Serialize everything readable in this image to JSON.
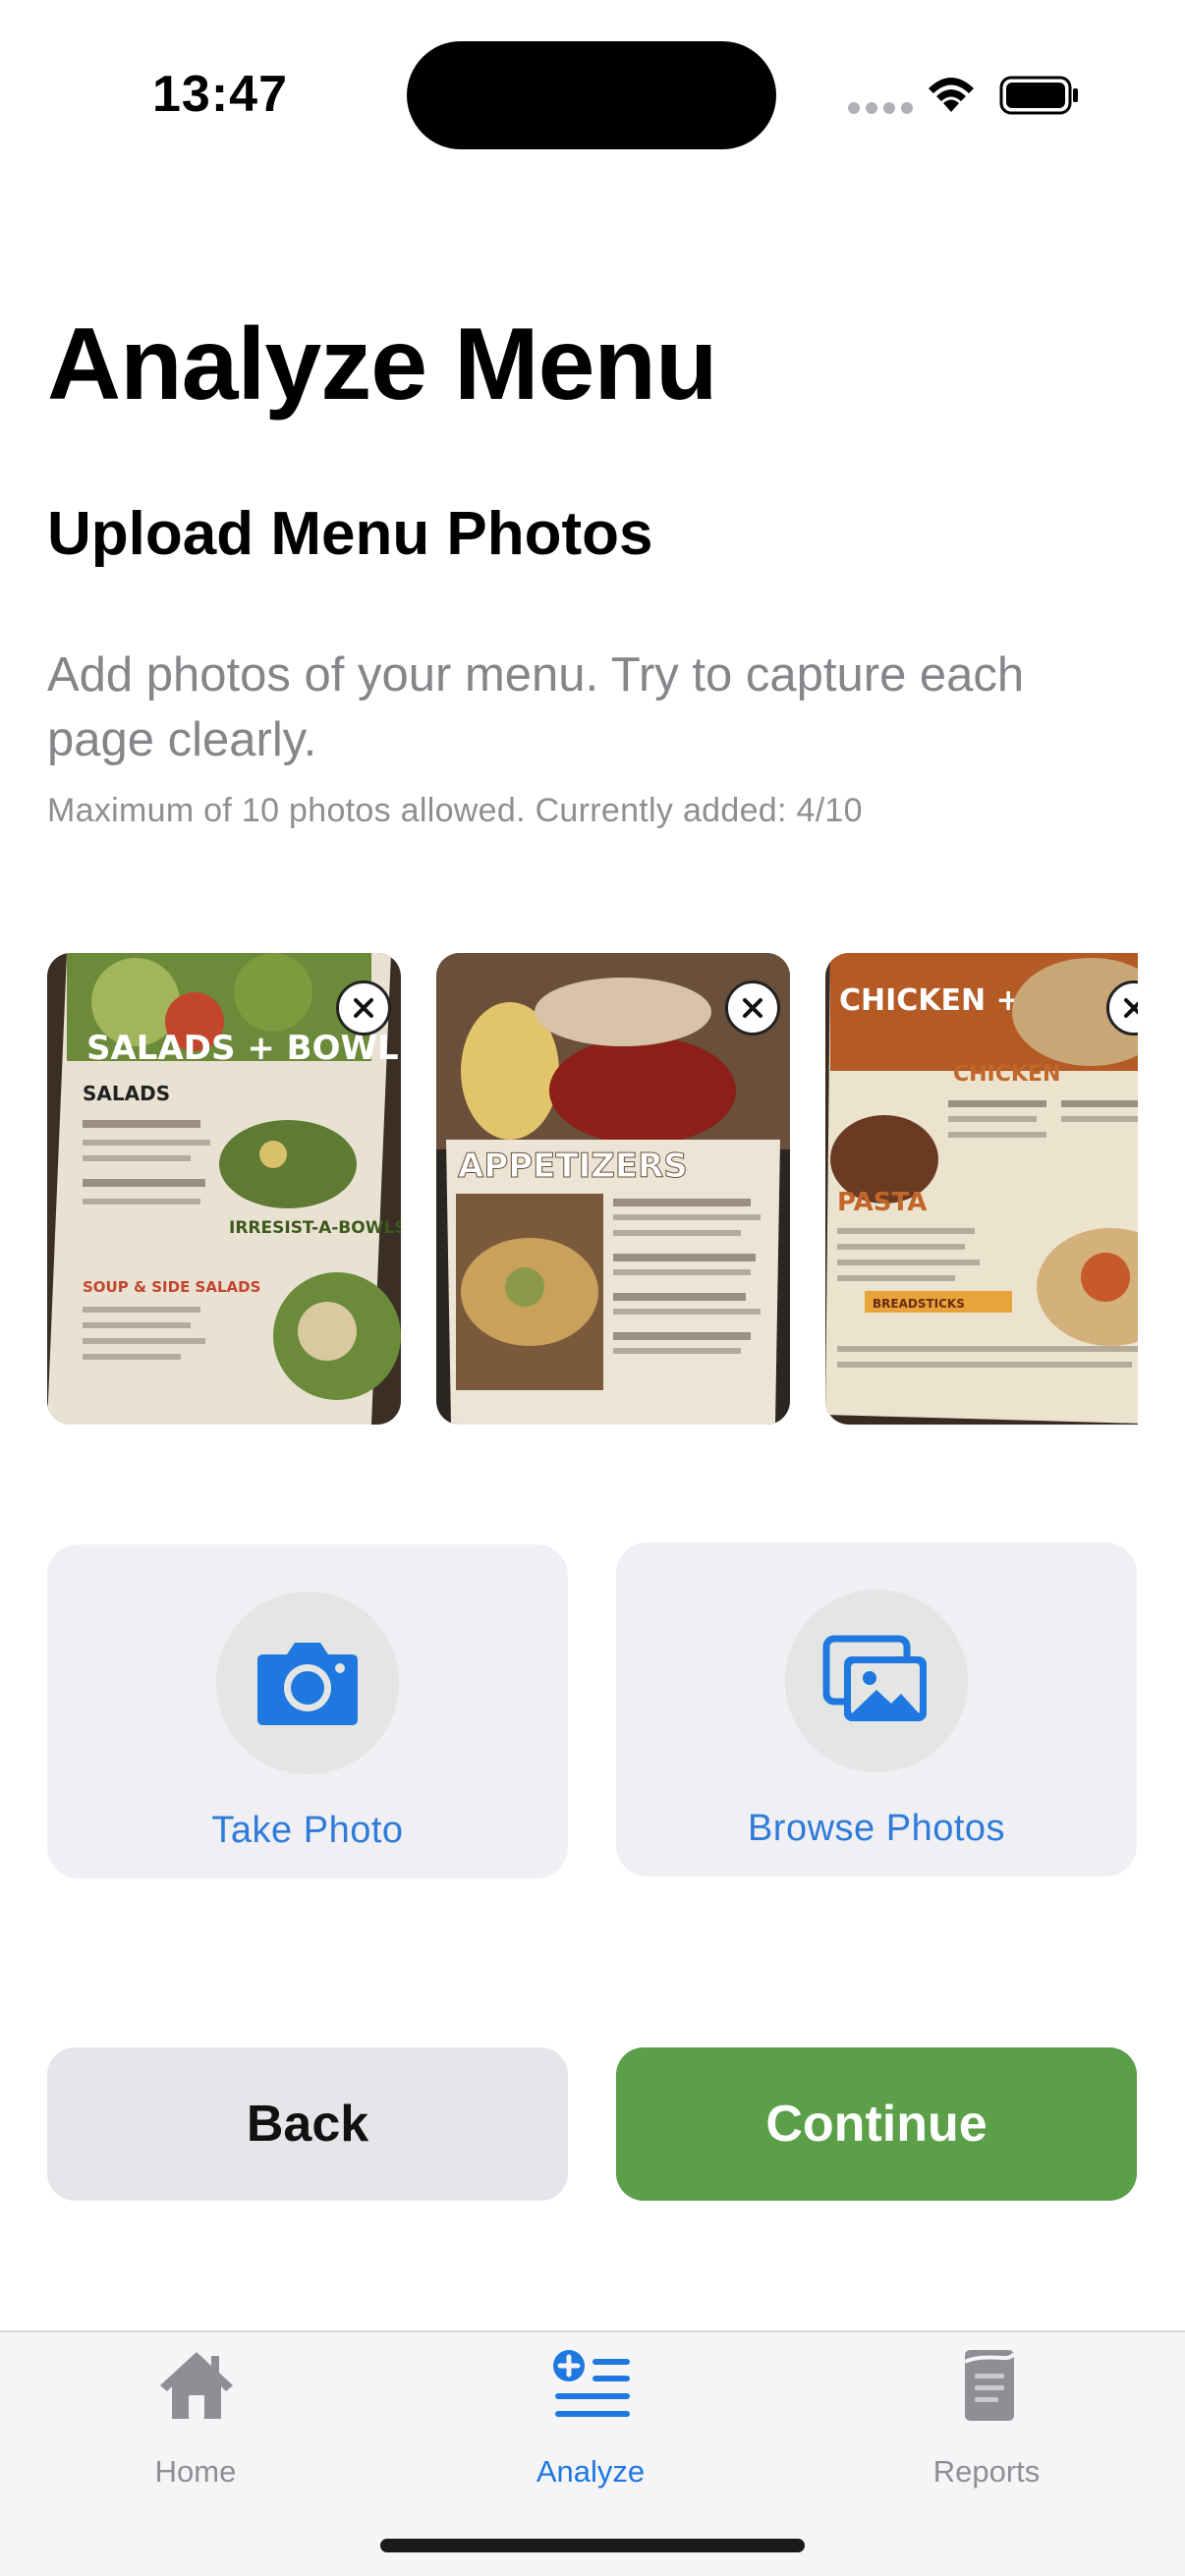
{
  "status_bar": {
    "time": "13:47"
  },
  "header": {
    "title": "Analyze Menu",
    "section_title": "Upload Menu Photos",
    "description": "Add photos of your menu. Try to capture each page clearly.",
    "limit_note": "Maximum of 10 photos allowed. Currently added: 4/10"
  },
  "photos": {
    "max": 10,
    "added": 4,
    "items": [
      {
        "headline": "SALADS + BOWLS",
        "subheads": [
          "SALADS",
          "IRRESIST-A-BOWLS",
          "SOUP & SIDE SALADS"
        ]
      },
      {
        "headline": "APPETIZERS",
        "subheads": []
      },
      {
        "headline": "CHICKEN + PASTA",
        "subheads": [
          "CHICKEN",
          "PASTA",
          "BREADSTICKS"
        ]
      }
    ]
  },
  "actions": {
    "take_photo": "Take Photo",
    "browse_photos": "Browse Photos"
  },
  "buttons": {
    "back": "Back",
    "continue": "Continue"
  },
  "tab_bar": {
    "tabs": [
      {
        "label": "Home",
        "icon": "house-icon",
        "active": false
      },
      {
        "label": "Analyze",
        "icon": "list-add-icon",
        "active": true
      },
      {
        "label": "Reports",
        "icon": "document-icon",
        "active": false
      }
    ]
  },
  "colors": {
    "accent_blue": "#1f77e0",
    "continue_green": "#5b9f48",
    "card_background": "#efeff4",
    "secondary_text": "#85858a"
  }
}
